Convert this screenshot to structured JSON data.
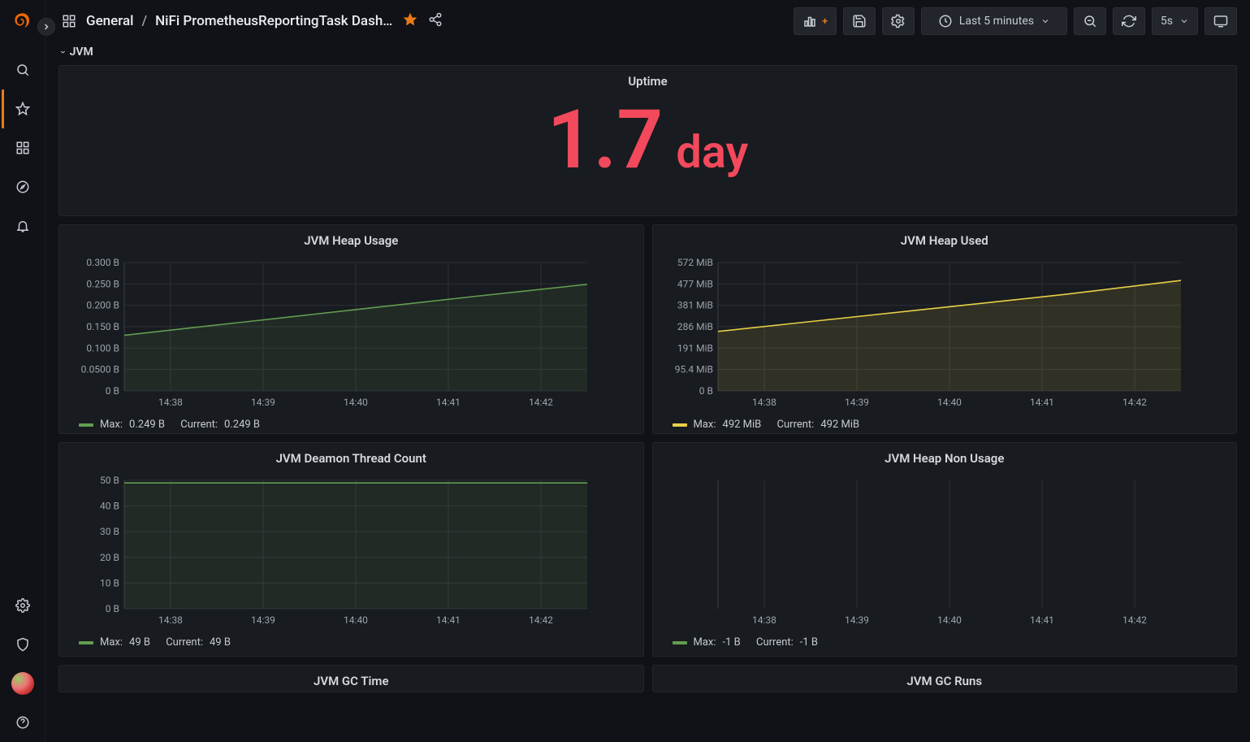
{
  "breadcrumb": {
    "root": "General",
    "separator": "/",
    "title": "NiFi PrometheusReportingTask Dash…"
  },
  "toolbar": {
    "time_range_label": "Last 5 minutes",
    "refresh_interval": "5s"
  },
  "section": {
    "jvm_label": "JVM"
  },
  "uptime": {
    "title": "Uptime",
    "value": "1.7",
    "unit": "day"
  },
  "legend_labels": {
    "max": "Max:",
    "current": "Current:"
  },
  "chart_data": [
    {
      "id": "heap_usage",
      "type": "area",
      "title": "JVM Heap Usage",
      "color": "#629e51",
      "x": [
        "14:38",
        "14:39",
        "14:40",
        "14:41",
        "14:42"
      ],
      "yticks": [
        "0 B",
        "0.0500 B",
        "0.100 B",
        "0.150 B",
        "0.200 B",
        "0.250 B",
        "0.300 B"
      ],
      "ylim": [
        0,
        0.3
      ],
      "values": [
        0.13,
        0.16,
        0.19,
        0.22,
        0.249
      ],
      "legend": {
        "max": "0.249 B",
        "current": "0.249 B"
      }
    },
    {
      "id": "heap_used",
      "type": "area",
      "title": "JVM Heap Used",
      "color": "#e8d148",
      "x": [
        "14:38",
        "14:39",
        "14:40",
        "14:41",
        "14:42"
      ],
      "yticks": [
        "0 B",
        "95.4 MiB",
        "191 MiB",
        "286 MiB",
        "381 MiB",
        "477 MiB",
        "572 MiB"
      ],
      "ylim": [
        0,
        572
      ],
      "values": [
        265,
        320,
        375,
        430,
        492
      ],
      "legend": {
        "max": "492 MiB",
        "current": "492 MiB"
      }
    },
    {
      "id": "daemon_threads",
      "type": "area",
      "title": "JVM Deamon Thread Count",
      "color": "#629e51",
      "x": [
        "14:38",
        "14:39",
        "14:40",
        "14:41",
        "14:42"
      ],
      "yticks": [
        "0 B",
        "10 B",
        "20 B",
        "30 B",
        "40 B",
        "50 B"
      ],
      "ylim": [
        0,
        50
      ],
      "values": [
        49,
        49,
        49,
        49,
        49
      ],
      "legend": {
        "max": "49 B",
        "current": "49 B"
      }
    },
    {
      "id": "heap_non_usage",
      "type": "area",
      "title": "JVM Heap Non Usage",
      "color": "#629e51",
      "x": [
        "14:38",
        "14:39",
        "14:40",
        "14:41",
        "14:42"
      ],
      "yticks": [],
      "ylim": [
        0,
        1
      ],
      "values": [],
      "legend": {
        "max": "-1 B",
        "current": "-1 B"
      }
    }
  ],
  "cutoff_titles": {
    "left": "JVM GC Time",
    "right": "JVM GC Runs"
  }
}
